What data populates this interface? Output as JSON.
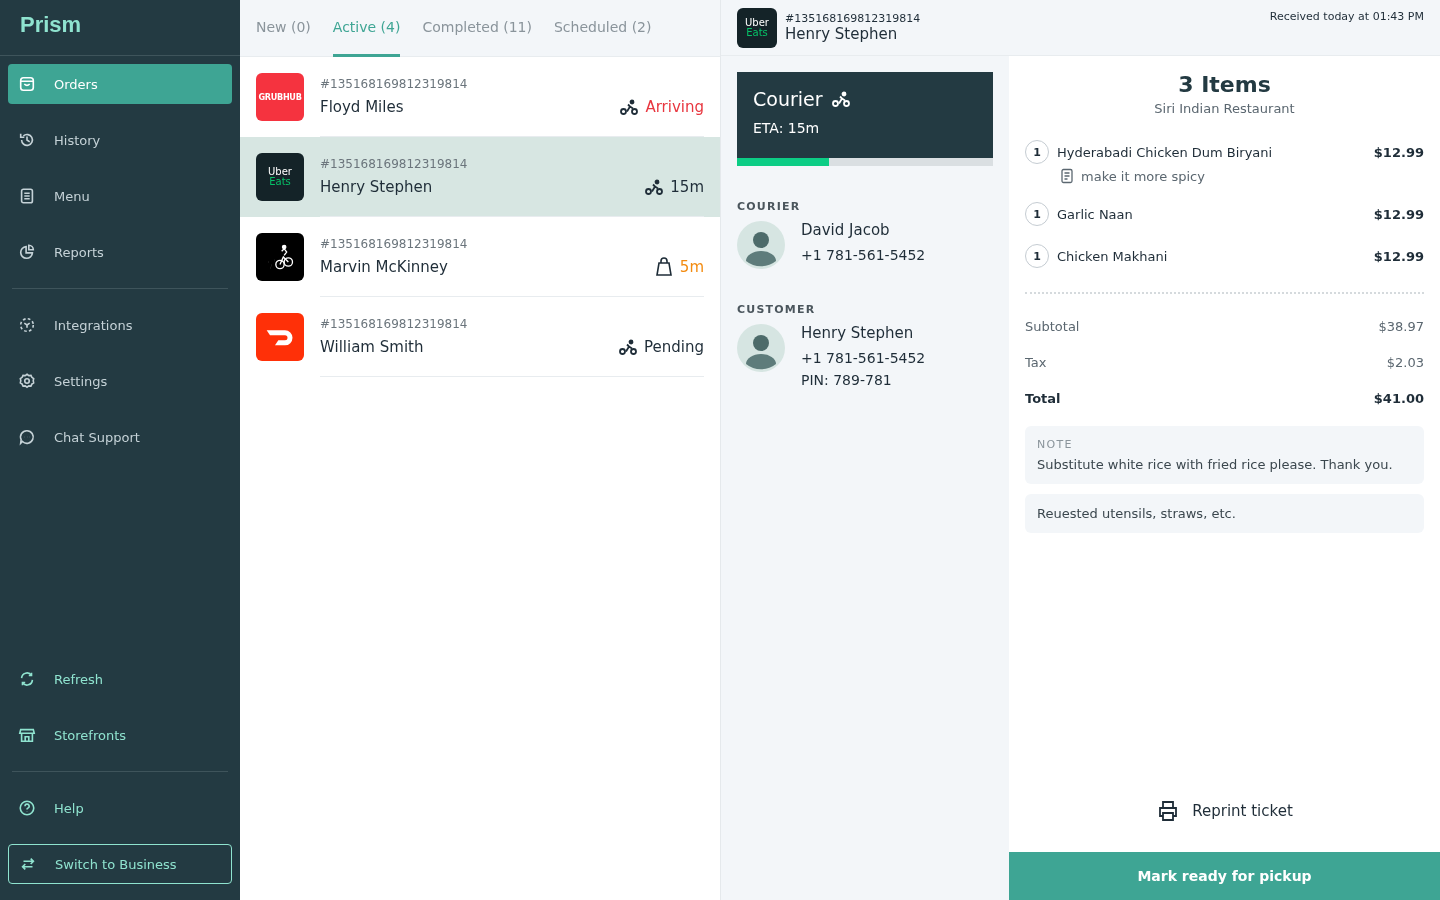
{
  "brand": "Prism",
  "nav_sections": [
    {
      "kind": "top",
      "items": [
        {
          "label": "Orders",
          "selected": true
        },
        {
          "label": "History",
          "selected": false
        },
        {
          "label": "Menu",
          "selected": false
        },
        {
          "label": "Reports",
          "selected": false
        }
      ]
    },
    {
      "kind": "top",
      "items": [
        {
          "label": "Integrations",
          "selected": false
        },
        {
          "label": "Settings",
          "selected": false
        },
        {
          "label": "Chat Support",
          "selected": false
        }
      ]
    },
    {
      "kind": "bottom",
      "items": [
        {
          "label": "Refresh",
          "selected": false
        },
        {
          "label": "Storefronts",
          "selected": false
        }
      ]
    },
    {
      "kind": "bottom",
      "items": [
        {
          "label": "Help",
          "selected": false
        }
      ]
    }
  ],
  "switch_button": "Switch to Business",
  "tabs": [
    {
      "label": "New (0)",
      "selected": false
    },
    {
      "label": "Active (4)",
      "selected": true
    },
    {
      "label": "Completed (11)",
      "selected": false
    },
    {
      "label": "Scheduled (2)",
      "selected": false
    }
  ],
  "orders": [
    {
      "number": "#135168169812319814",
      "name": "Floyd Miles",
      "logo": {
        "kind": "grubhub",
        "text": "GRUBHUB"
      },
      "status": {
        "kind": "bike",
        "text": "Arriving",
        "color": "#e8363f"
      },
      "selected": false
    },
    {
      "number": "#135168169812319814",
      "name": "Henry Stephen",
      "logo": {
        "kind": "ubereats",
        "top": "Uber",
        "bottom": "Eats"
      },
      "status": {
        "kind": "bike",
        "text": "15m",
        "color": "#1f2d38"
      },
      "selected": true
    },
    {
      "number": "#135168169812319814",
      "name": "Marvin McKinney",
      "logo": {
        "kind": "postmates"
      },
      "status": {
        "kind": "bag",
        "text": "5m",
        "color": "#f38b10"
      },
      "selected": false
    },
    {
      "number": "#135168169812319814",
      "name": "William Smith",
      "logo": {
        "kind": "doordash"
      },
      "status": {
        "kind": "bike",
        "text": "Pending",
        "color": "#1f2d38"
      },
      "selected": false
    }
  ],
  "detail": {
    "logo": {
      "kind": "ubereats",
      "top": "Uber",
      "bottom": "Eats"
    },
    "number": "#135168169812319814",
    "name": "Henry Stephen",
    "received": "Received today at 01:43 PM",
    "courier_card": {
      "title": "Courier",
      "eta": "ETA: 15m",
      "level": 0.36
    },
    "courier": {
      "heading": "COURIER",
      "name": "David Jacob",
      "phone": "+1 781-561-5452"
    },
    "customer": {
      "heading": "CUSTOMER",
      "name": "Henry Stephen",
      "phone": "+1 781-561-5452",
      "pin": "PIN: 789-781"
    }
  },
  "receipt": {
    "title": "3 Items",
    "restaurant": "Siri Indian Restaurant",
    "items": [
      {
        "qty": "1",
        "name": "Hyderabadi Chicken Dum Biryani",
        "price": "$12.99",
        "note": "make it more spicy"
      },
      {
        "qty": "1",
        "name": "Garlic Naan",
        "price": "$12.99"
      },
      {
        "qty": "1",
        "name": "Chicken Makhani",
        "price": "$12.99"
      }
    ],
    "totals": [
      {
        "label": "Subtotal",
        "value": "$38.97",
        "bold": false
      },
      {
        "label": "Tax",
        "value": "$2.03",
        "bold": false
      },
      {
        "label": "Total",
        "value": "$41.00",
        "bold": true
      }
    ],
    "note": {
      "heading": "NOTE",
      "text": "Substitute white rice with fried rice please. Thank you."
    },
    "request": "Reuested utensils, straws, etc.",
    "reprint": "Reprint ticket",
    "primary_button": "Mark ready for pickup"
  }
}
